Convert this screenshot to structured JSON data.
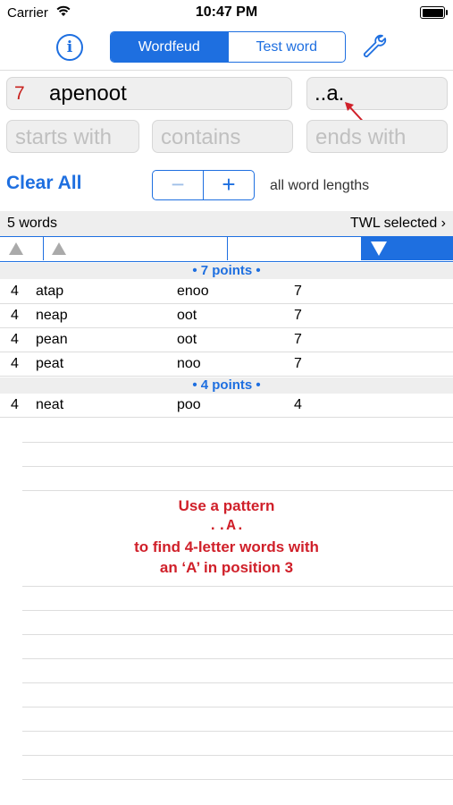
{
  "status": {
    "carrier": "Carrier",
    "time": "10:47 PM"
  },
  "toolbar": {
    "info_label": "i",
    "segments": [
      {
        "label": "Wordfeud",
        "selected": true
      },
      {
        "label": "Test word",
        "selected": false
      }
    ],
    "accent_color": "#1e6fe0"
  },
  "inputs": {
    "letter_count": "7",
    "letters": "apenoot",
    "pattern": "..a.",
    "starts_with_placeholder": "starts with",
    "contains_placeholder": "contains",
    "ends_with_placeholder": "ends with"
  },
  "controls": {
    "clear_all": "Clear All",
    "minus": "−",
    "plus": "+",
    "lengths_label": "all word lengths"
  },
  "results": {
    "count_label": "5 words",
    "dictionary_label": "TWL selected",
    "groups": [
      {
        "header": "• 7 points •",
        "rows": [
          {
            "len": "4",
            "word": "atap",
            "rest": "enoo",
            "points": "7"
          },
          {
            "len": "4",
            "word": "neap",
            "rest": "oot",
            "points": "7"
          },
          {
            "len": "4",
            "word": "pean",
            "rest": "oot",
            "points": "7"
          },
          {
            "len": "4",
            "word": "peat",
            "rest": "noo",
            "points": "7"
          }
        ]
      },
      {
        "header": "• 4 points •",
        "rows": [
          {
            "len": "4",
            "word": "neat",
            "rest": "poo",
            "points": "4"
          }
        ]
      }
    ]
  },
  "hint": {
    "line1": "Use a pattern",
    "line2": "..A.",
    "line3": "to find 4-letter words with",
    "line4": "an ‘A’ in position 3"
  }
}
